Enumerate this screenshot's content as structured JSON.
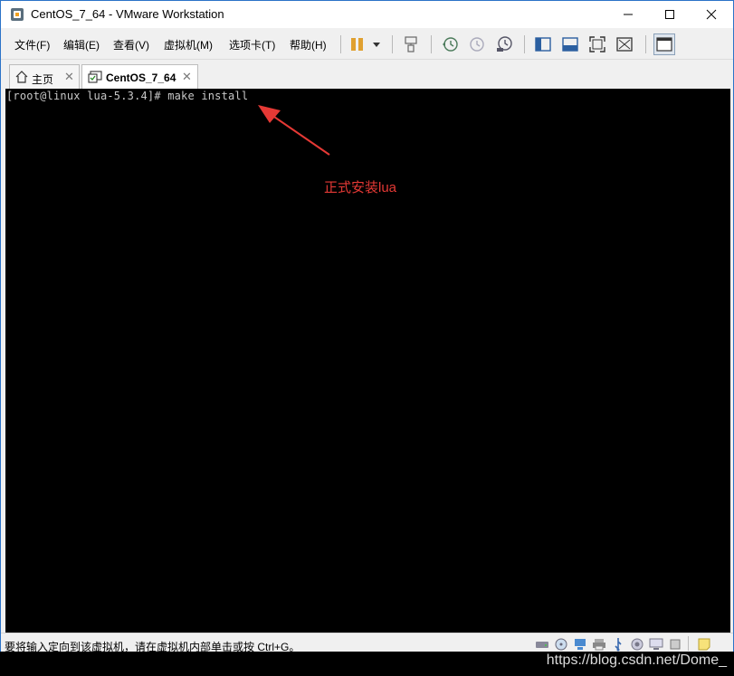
{
  "window": {
    "title": "CentOS_7_64 - VMware Workstation"
  },
  "menu": [
    {
      "label": "文件(F)"
    },
    {
      "label": "编辑(E)"
    },
    {
      "label": "查看(V)"
    },
    {
      "label": "虚拟机(M)"
    },
    {
      "label": "选项卡(T)"
    },
    {
      "label": "帮助(H)"
    }
  ],
  "tabs": [
    {
      "label": "主页",
      "icon": "home-icon"
    },
    {
      "label": "CentOS_7_64",
      "icon": "vm-icon"
    }
  ],
  "console": {
    "command_line": "[root@linux lua-5.3.4]# make install",
    "annotation": "正式安装lua",
    "annotation_color": "#e53935"
  },
  "status": {
    "message": "要将输入定向到该虚拟机，请在虚拟机内部单击或按 Ctrl+G。"
  },
  "watermark": "https://blog.csdn.net/Dome_",
  "colors": {
    "accent": "#2b73c8",
    "pause": "#e0a030",
    "console_bg": "#000000"
  }
}
